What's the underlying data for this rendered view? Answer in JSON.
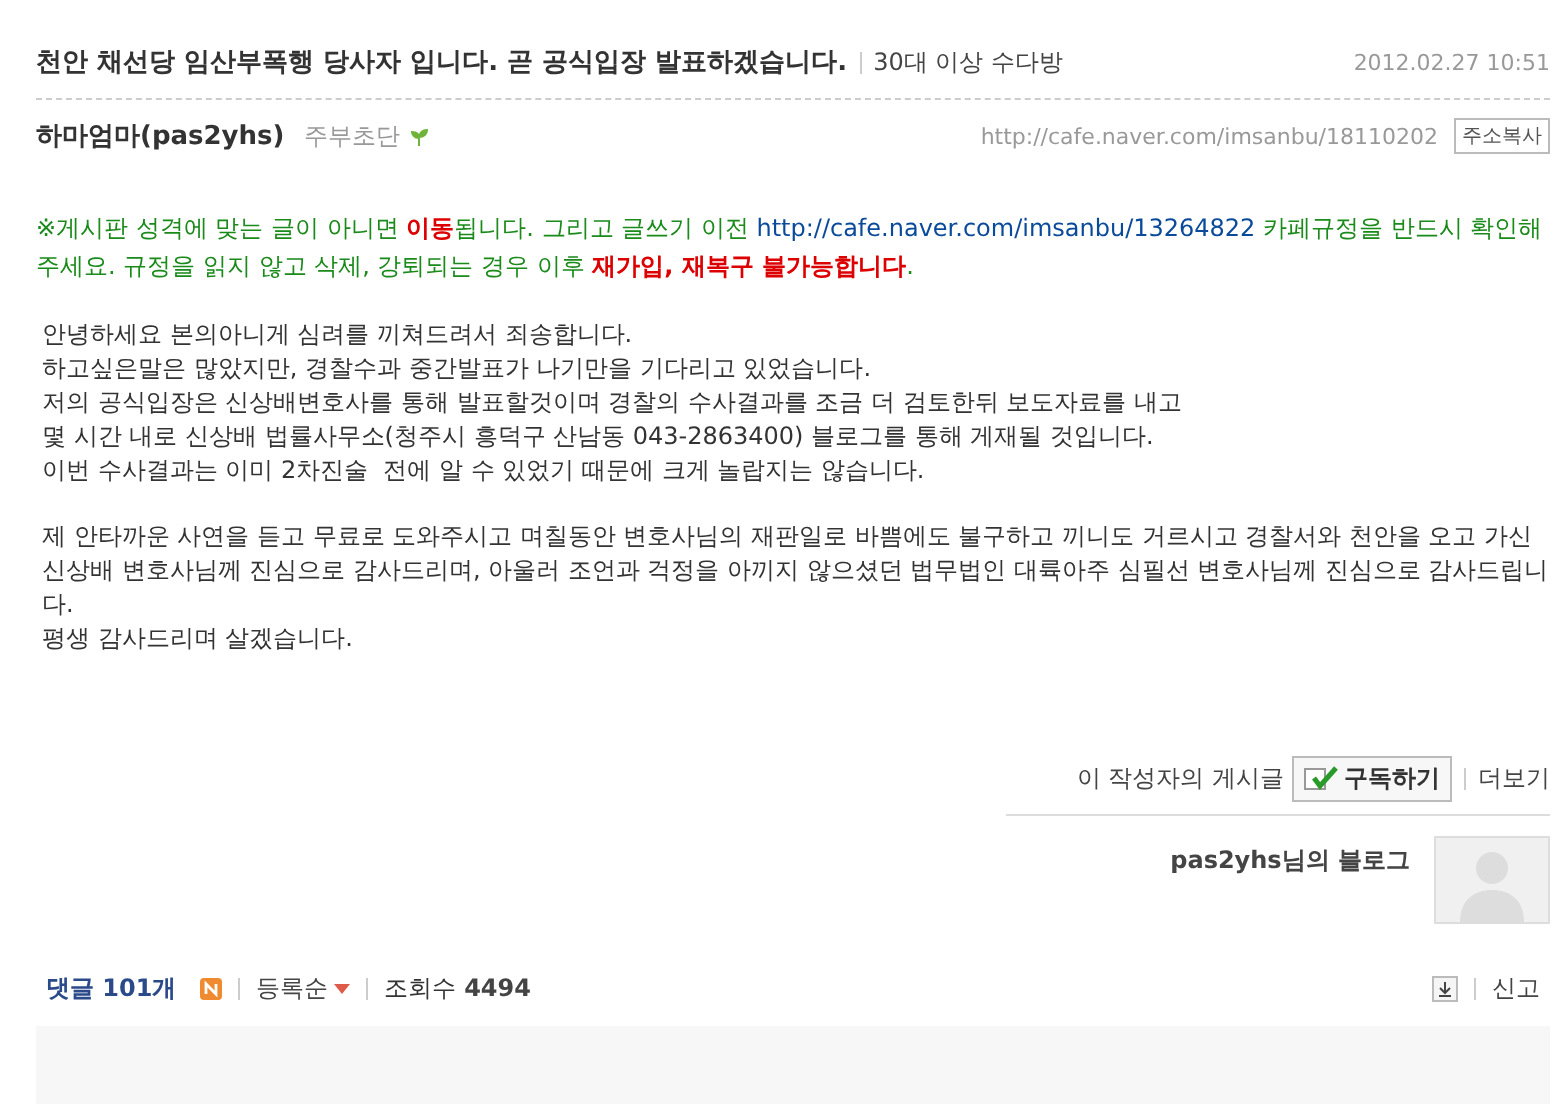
{
  "post": {
    "title": "천안 채선당 임산부폭행 당사자 입니다. 곧 공식입장 발표하겠습니다.",
    "board": "30대 이상 수다방",
    "date": "2012.02.27 10:51",
    "author": "하마엄마(pas2yhs)",
    "rank": "주부초단",
    "url": "http://cafe.naver.com/imsanbu/18110202",
    "copy_button": "주소복사"
  },
  "notice": [
    {
      "kind": "text",
      "text": "※게시판 성격에 맞는 글이 아니면 "
    },
    {
      "kind": "strong",
      "text": "이동"
    },
    {
      "kind": "text",
      "text": "됩니다. 그리고 글쓰기 이전 "
    },
    {
      "kind": "link",
      "text": "http://cafe.naver.com/imsanbu/13264822"
    },
    {
      "kind": "text",
      "text": " 카페규정을 반드시 확인해주세요. 규정을 읽지 않고 삭제, 강퇴되는 경우 이후 "
    },
    {
      "kind": "strong",
      "text": "재가입, 재복구 불가능합니다"
    },
    {
      "kind": "text",
      "text": "."
    }
  ],
  "paragraphs": [
    [
      "안녕하세요 본의아니게 심려를 끼쳐드려서 죄송합니다.",
      "하고싶은말은 많았지만, 경찰수과 중간발표가 나기만을 기다리고 있었습니다.",
      "저의 공식입장은 신상배변호사를 통해 발표할것이며 경찰의 수사결과를 조금 더 검토한뒤 보도자료를 내고",
      "몇 시간 내로 신상배 법률사무소(청주시 흥덕구 산남동 043-2863400) 블로그를 통해 게재될 것입니다.",
      "이번 수사결과는 이미 2차진술  전에 알 수 있었기 때문에 크게 놀랍지는 않습니다."
    ],
    [
      "제 안타까운 사연을 듣고 무료로 도와주시고 며칠동안 변호사님의 재판일로 바쁨에도 불구하고 끼니도 거르시고 경찰서와 천안을 오고 가신 신상배 변호사님께 진심으로 감사드리며, 아울러 조언과 걱정을 아끼지 않으셨던 법무법인 대륙아주 심필선 변호사님께 진심으로 감사드립니다.",
      "평생 감사드리며 살겠습니다."
    ]
  ],
  "author_box": {
    "label": "이 작성자의 게시글",
    "subscribe": "구독하기",
    "more": "더보기",
    "blog": "pas2yhs님의 블로그"
  },
  "comments": {
    "label": "댓글",
    "count": "101개",
    "sort": "등록순",
    "views_label": "조회수",
    "views": "4494",
    "report": "신고"
  }
}
